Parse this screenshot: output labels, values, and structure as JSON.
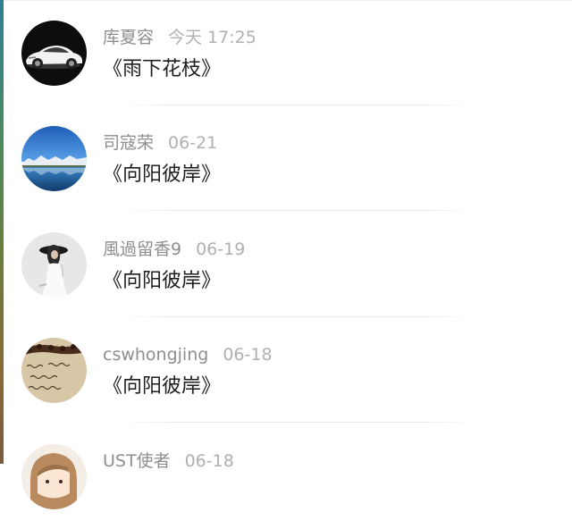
{
  "comments": [
    {
      "user": "库夏容",
      "time": "今天 17:25",
      "content": "《雨下花枝》",
      "avatar_icon": "sports-car-avatar"
    },
    {
      "user": "司寇荣",
      "time": "06-21",
      "content": "《向阳彼岸》",
      "avatar_icon": "mountain-lake-avatar"
    },
    {
      "user": "風過留香9",
      "time": "06-19",
      "content": "《向阳彼岸》",
      "avatar_icon": "girl-portrait-avatar"
    },
    {
      "user": "cswhongjing",
      "time": "06-18",
      "content": "《向阳彼岸》",
      "avatar_icon": "handwritten-note-avatar"
    },
    {
      "user": "UST使者",
      "time": "06-18",
      "content": "",
      "avatar_icon": "cartoon-girl-avatar"
    }
  ],
  "colors": {
    "username": "#8e8e8e",
    "timestamp": "#b0b0b0",
    "content": "#1e1e1e",
    "divider": "#ebebeb"
  }
}
